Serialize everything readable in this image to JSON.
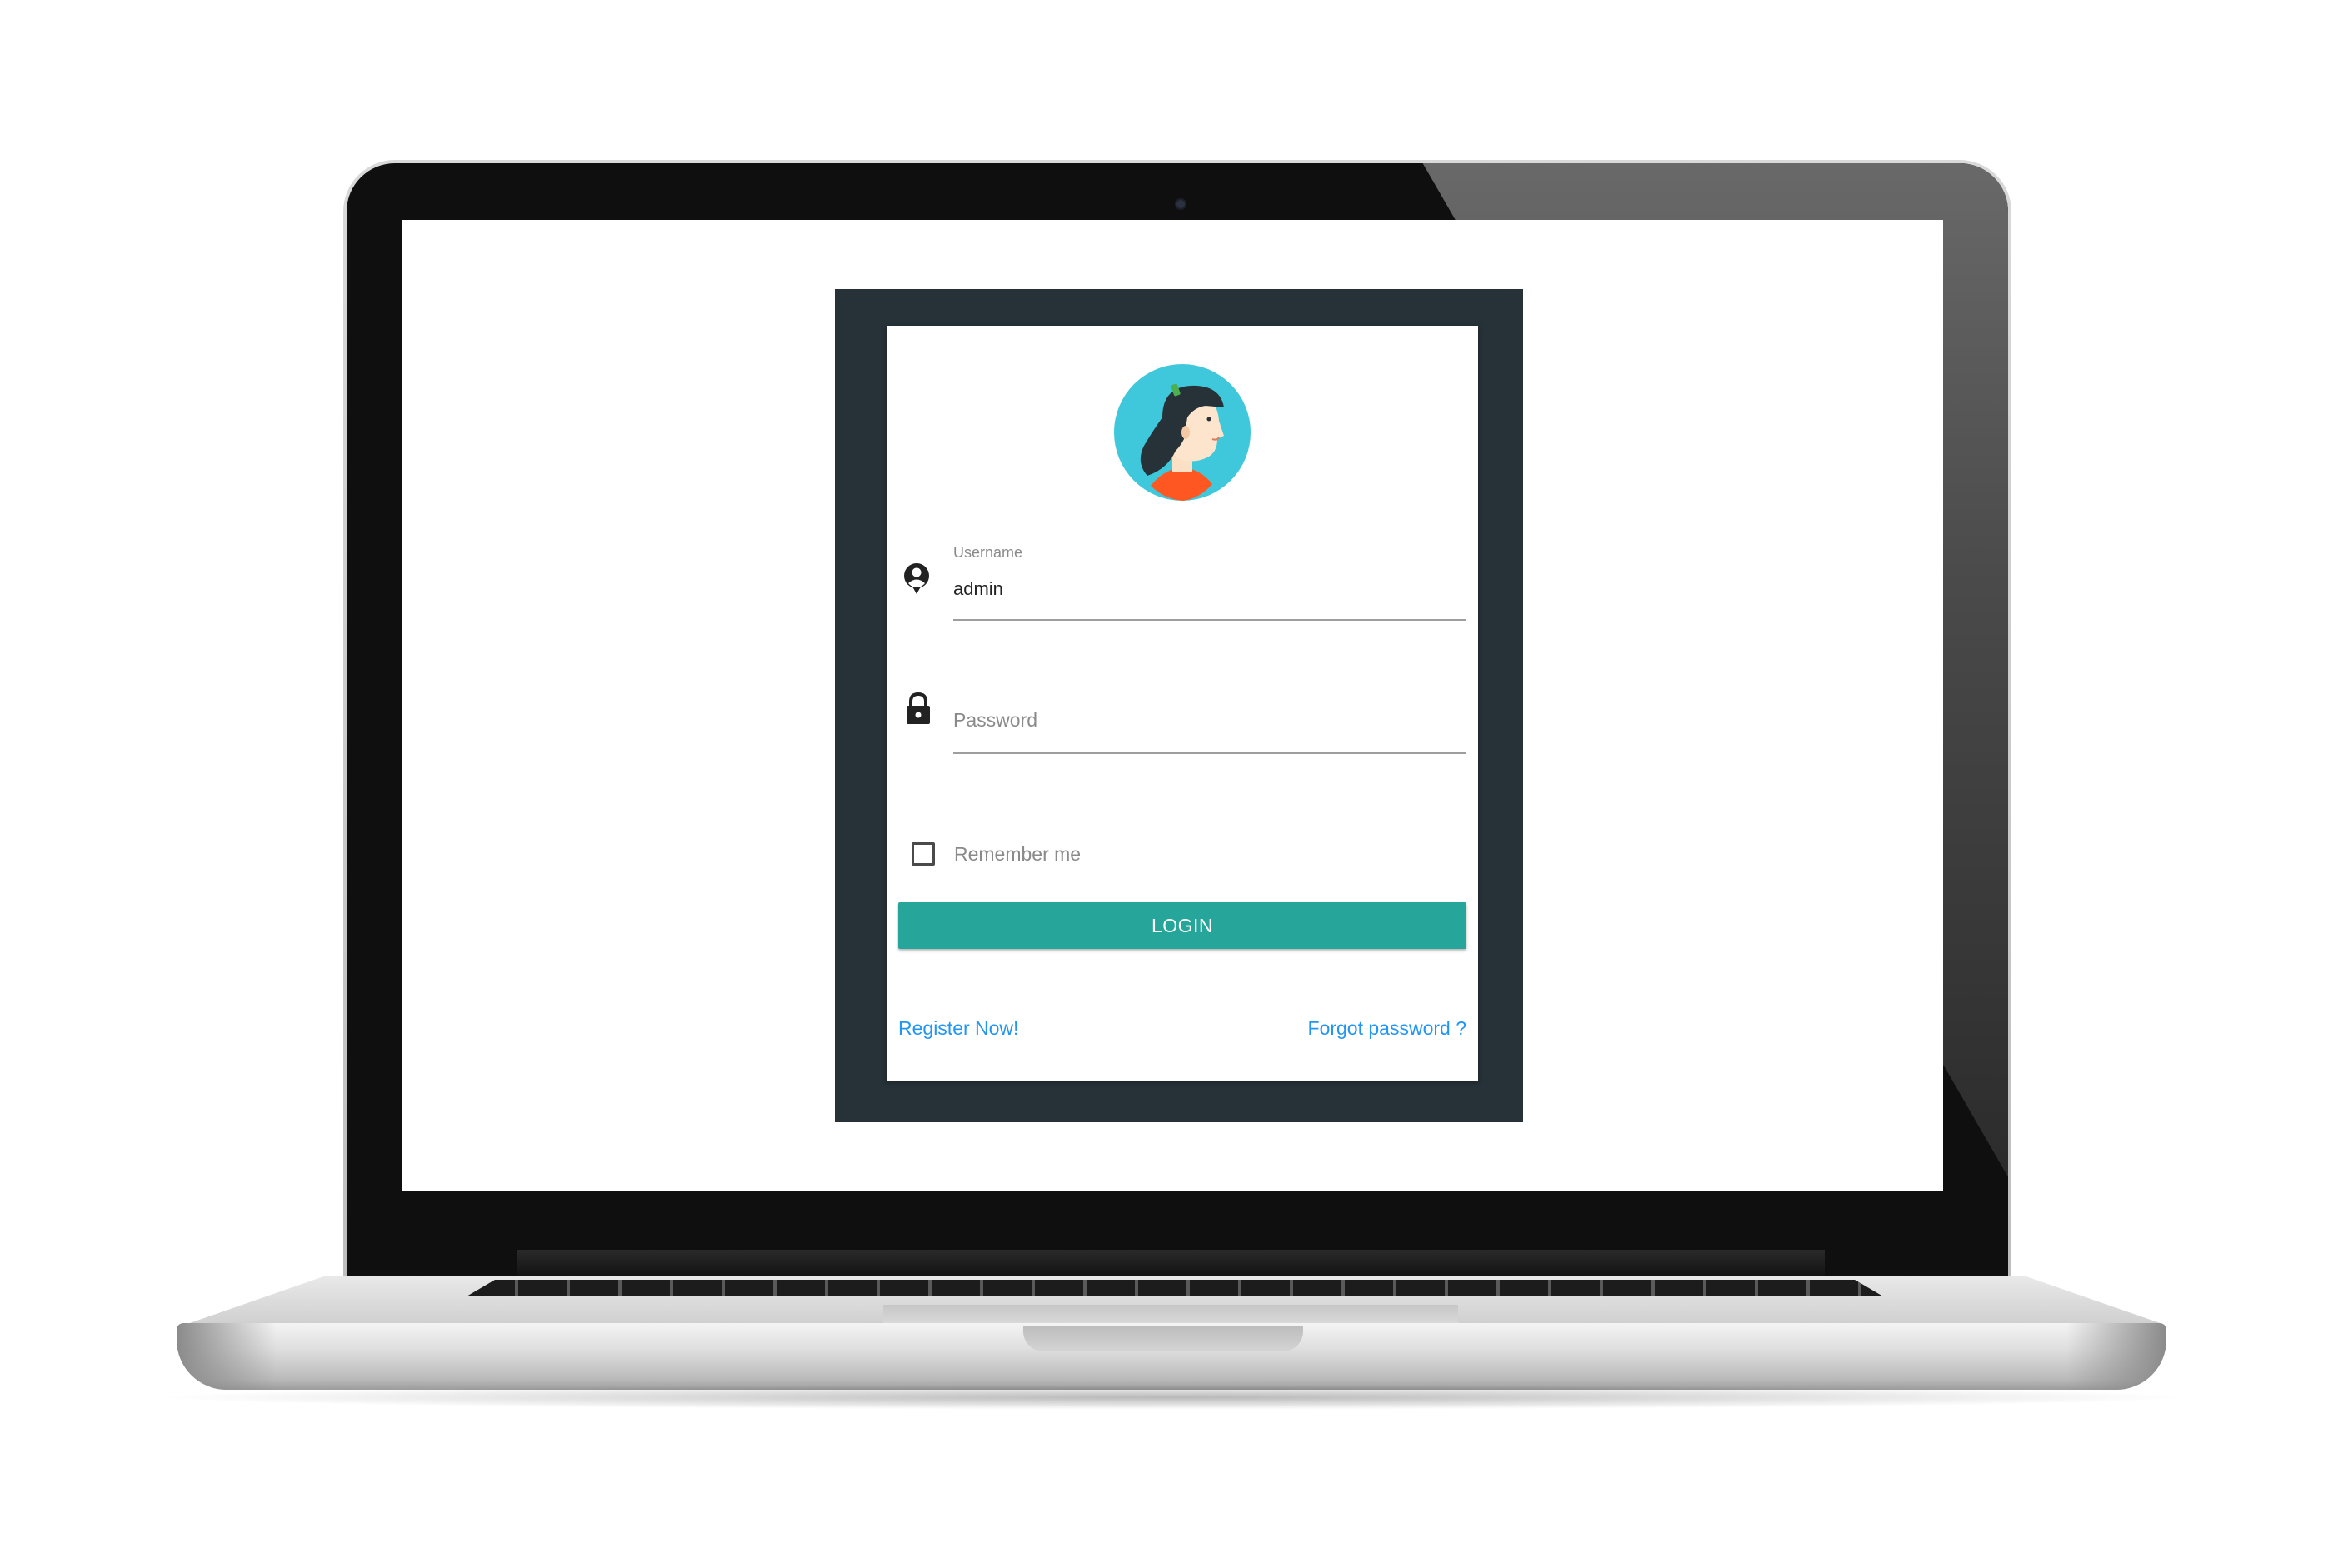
{
  "login_form": {
    "username_label": "Username",
    "username_value": "admin",
    "password_placeholder": "Password",
    "remember_me_label": "Remember me",
    "remember_me_checked": false,
    "login_button": "LOGIN",
    "register_link": "Register Now!",
    "forgot_password_link": "Forgot password ?"
  },
  "icons": {
    "avatar": "woman-avatar-icon",
    "username": "account-icon",
    "password": "lock-icon",
    "remember": "checkbox-icon"
  },
  "colors": {
    "frame_background": "#263238",
    "button": "#26a69a",
    "link": "#2196f3",
    "avatar_background": "#3fc7dc"
  }
}
